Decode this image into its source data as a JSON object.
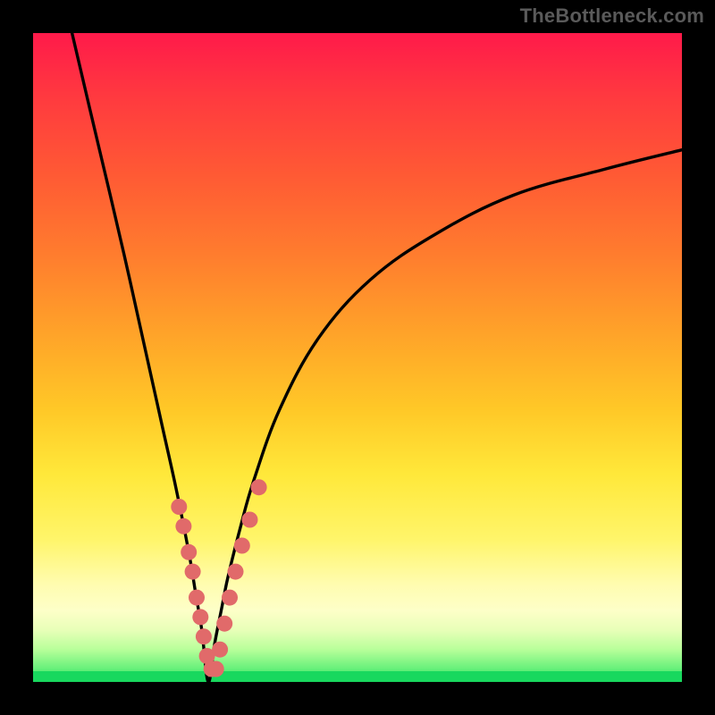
{
  "watermark": "TheBottleneck.com",
  "colors": {
    "background": "#000000",
    "curve_stroke": "#000000",
    "marker_fill": "#e16a6a",
    "gradient_top": "#ff1a4a",
    "gradient_bottom": "#18d85e"
  },
  "chart_data": {
    "type": "line",
    "title": "",
    "xlabel": "",
    "ylabel": "",
    "xlim": [
      0,
      100
    ],
    "ylim": [
      0,
      100
    ],
    "notch_x": 27,
    "series": [
      {
        "name": "bottleneck_curve",
        "x": [
          6,
          10,
          14,
          18,
          20,
          22,
          24,
          25,
          26,
          27,
          28,
          29,
          30,
          32,
          34,
          38,
          44,
          52,
          62,
          74,
          88,
          100
        ],
        "values": [
          100,
          83,
          66,
          48,
          39,
          30,
          20,
          14,
          8,
          0,
          6,
          11,
          16,
          24,
          31,
          42,
          53,
          62,
          69,
          75,
          79,
          82
        ]
      }
    ],
    "markers": {
      "name": "highlight_points",
      "x": [
        22.5,
        23.2,
        24.0,
        24.6,
        25.2,
        25.8,
        26.3,
        26.8,
        27.5,
        28.2,
        28.8,
        29.5,
        30.3,
        31.2,
        32.2,
        33.4,
        34.8
      ],
      "values": [
        27,
        24,
        20,
        17,
        13,
        10,
        7,
        4,
        2,
        2,
        5,
        9,
        13,
        17,
        21,
        25,
        30
      ]
    }
  }
}
